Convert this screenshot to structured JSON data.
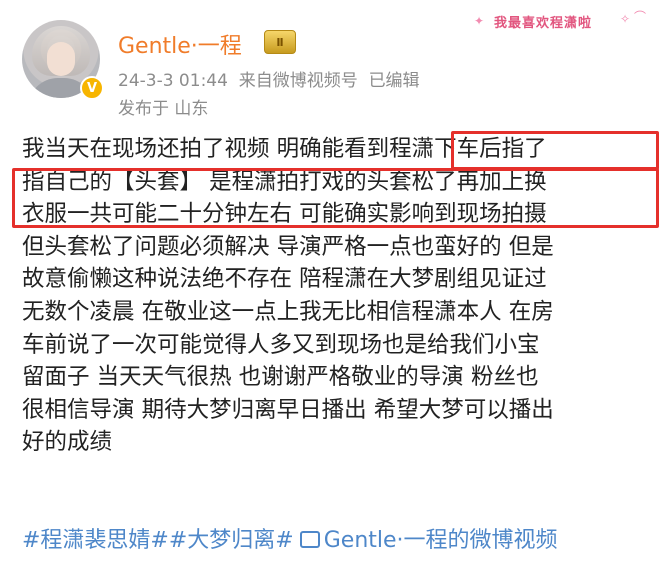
{
  "post": {
    "username": "Gentle·一程",
    "level_badge": "Ⅱ",
    "verified_badge": "V",
    "timestamp": "24-3-3 01:44",
    "source_prefix": "来自",
    "source_name": "微博视频号",
    "edited": "已编辑",
    "location": "发布于 山东",
    "sticker_text": "我最喜欢程潇啦",
    "body_lines": [
      "我当天在现场还拍了视频 明确能看到程潇下车后指了",
      "指自己的【头套】 是程潇拍打戏的头套松了再加上换",
      "衣服一共可能二十分钟左右 可能确实影响到现场拍摄",
      "但头套松了问题必须解决 导演严格一点也蛮好的 但是",
      "故意偷懒这种说法绝不存在 陪程潇在大梦剧组见证过",
      "无数个凌晨 在敬业这一点上我无比相信程潇本人 在房",
      "车前说了一次可能觉得人多又到现场也是给我们小宝",
      "留面子 当天天气很热 也谢谢严格敬业的导演 粉丝也",
      "很相信导演 期待大梦归离早日播出 希望大梦可以播出",
      "好的成绩"
    ],
    "hashtag_1": "#程潇裴思婧#",
    "hashtag_2": "#大梦归离#",
    "video_link": "Gentle·一程的微博视频"
  },
  "colors": {
    "username": "#f07c2a",
    "link": "#4e87c9",
    "highlight_border": "#e5302b",
    "meta": "#8c8c8c"
  }
}
